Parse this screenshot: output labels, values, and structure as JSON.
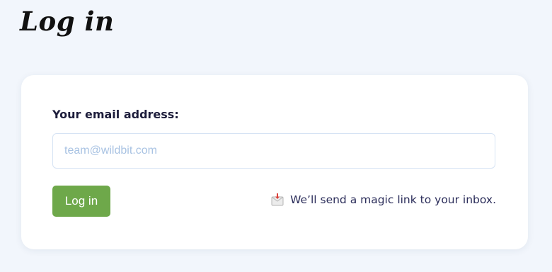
{
  "page": {
    "title": "Log in"
  },
  "form": {
    "email_label": "Your email address:",
    "email_placeholder": "team@wildbit.com",
    "email_value": "",
    "submit_label": "Log in",
    "hint_icon": "envelope-incoming-icon",
    "hint_text": "We’ll send a magic link to your inbox."
  },
  "colors": {
    "background": "#f2f6fc",
    "card": "#ffffff",
    "button": "#6ea84a",
    "label_text": "#1d1d3b",
    "hint_text": "#2b2d5a",
    "placeholder": "#a9c3e3"
  }
}
